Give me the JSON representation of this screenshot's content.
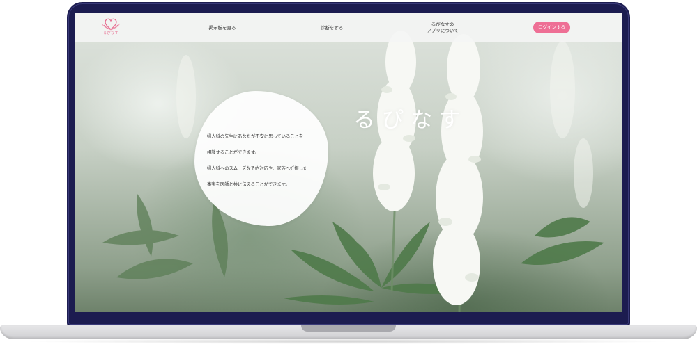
{
  "header": {
    "logo_text": "るぴなす",
    "nav": {
      "board": "掲示板を見る",
      "diagnose": "診断をする",
      "about_line1": "るぴなすの",
      "about_line2": "アプリについて"
    },
    "login_label": "ログインする"
  },
  "hero": {
    "title": "るぴなす",
    "lines": [
      "婦人科の先生にあなたが不安に思っていることを",
      "相談することができます。",
      "婦人科へのスムーズな予約対応や、家族へ妊娠した",
      "事実を医師と共に伝えることができます。"
    ]
  },
  "colors": {
    "accent": "#ee6f95",
    "frame": "#1c1c50",
    "nav_bg": "#f5f5f5"
  },
  "icons": {
    "logo": "lotus-heart-logo"
  }
}
